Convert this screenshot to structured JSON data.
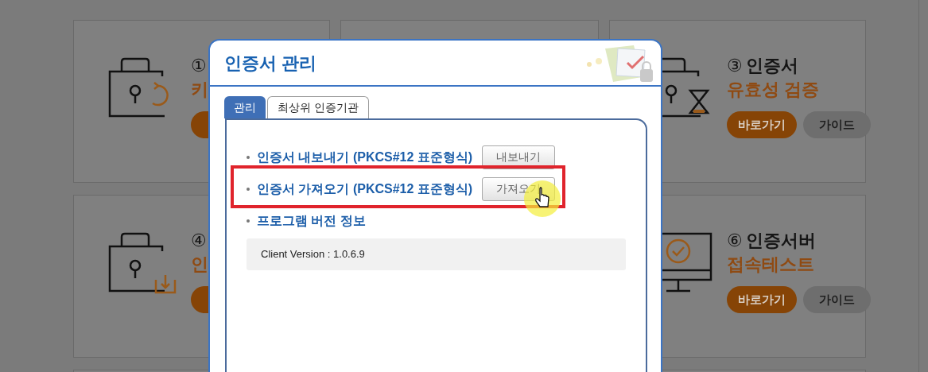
{
  "card_rows": [
    {
      "left": {
        "kind": "refresh",
        "number": "①",
        "subtitle": "키",
        "shortcut": true
      },
      "right": {
        "kind": "hourglass",
        "number": "③",
        "title": "인증서",
        "subtitle": "유효성 검증",
        "buttons": [
          "바로가기",
          "가이드"
        ]
      }
    },
    {
      "left": {
        "kind": "download",
        "number": "④",
        "subtitle": "인",
        "shortcut": true
      },
      "right": {
        "kind": "monitor",
        "number": "⑥",
        "title": "인증서버",
        "subtitle": "접속테스트",
        "buttons": [
          "바로가기",
          "가이드"
        ]
      }
    }
  ],
  "dialog": {
    "title": "인증서 관리",
    "tabs": [
      {
        "label": "관리",
        "selected": true
      },
      {
        "label": "최상위 인증기관",
        "selected": false
      }
    ],
    "rows": [
      {
        "label": "인증서 내보내기 (PKCS#12 표준형식)",
        "button": "내보내기",
        "highlighted": false,
        "pointer": false
      },
      {
        "label": "인증서 가져오기 (PKCS#12 표준형식)",
        "button": "가져오기",
        "highlighted": true,
        "pointer": true
      },
      {
        "label": "프로그램 버전 정보",
        "highlighted": false,
        "pointer": false
      }
    ],
    "version": "Client Version : 1.0.6.9"
  }
}
